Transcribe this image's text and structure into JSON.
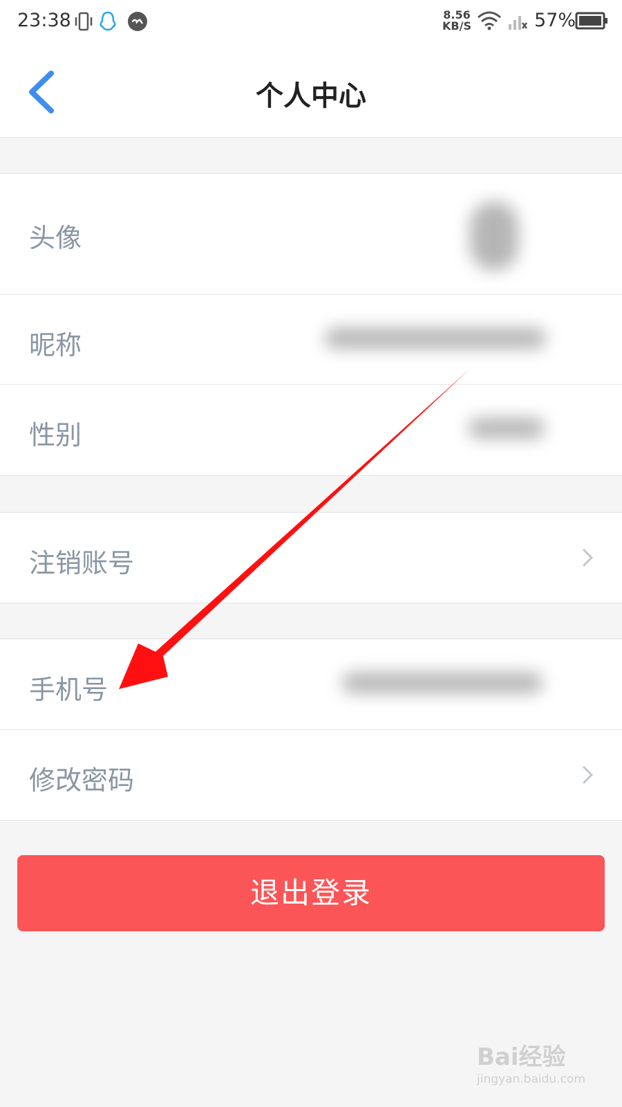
{
  "status_bar": {
    "time": "23:38",
    "net_speed_value": "8.56",
    "net_speed_unit": "KB/S",
    "battery": "57%"
  },
  "header": {
    "title": "个人中心",
    "back_icon": "chevron-left-icon"
  },
  "profile": {
    "avatar_label": "头像",
    "nickname_label": "昵称",
    "gender_label": "性别"
  },
  "account": {
    "cancel_account_label": "注销账号"
  },
  "security": {
    "phone_label": "手机号",
    "change_password_label": "修改密码"
  },
  "logout_button": "退出登录",
  "watermark": {
    "brand": "Bai经验",
    "url": "jingyan.baidu.com"
  },
  "colors": {
    "accent": "#3d8ef0",
    "logout": "#fb5557",
    "annotation_arrow": "#ff1010"
  }
}
